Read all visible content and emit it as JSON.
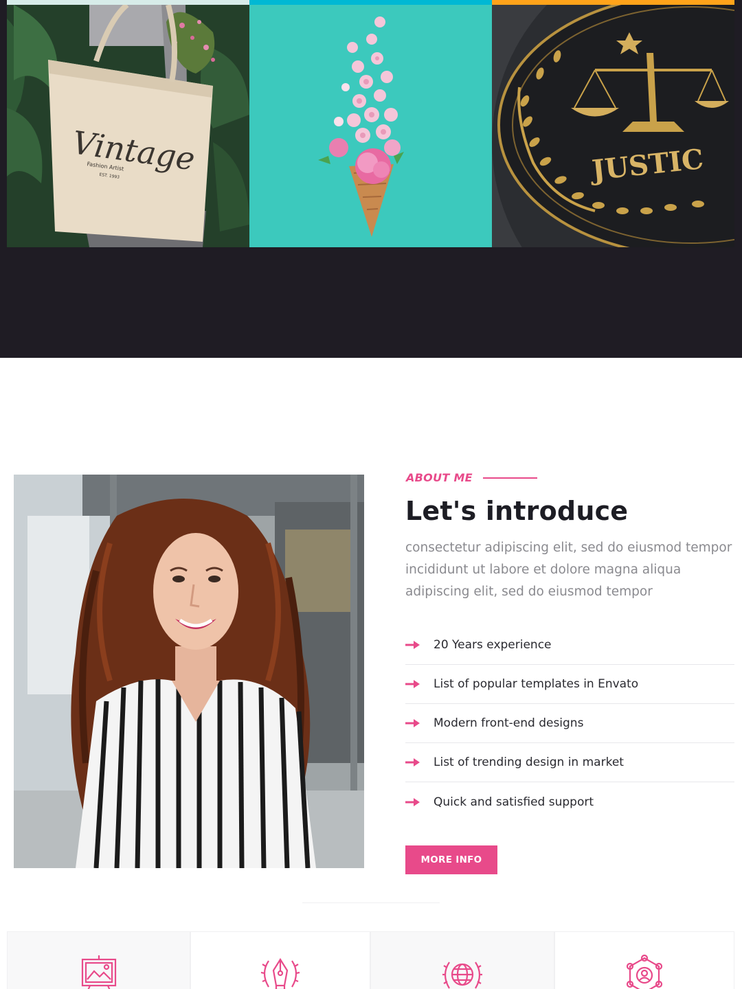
{
  "portfolio": {
    "strip_colors": [
      "#d7ece9",
      "#00b8d4",
      "#ffa31a"
    ],
    "items": [
      {
        "image": "vintage tote bag held in front of green leaves",
        "bag_script": "Vintage",
        "bag_caption": "Fashion Artist",
        "bag_est": "EST. 1993"
      },
      {
        "image": "pink flowers and meringues in an ice cream cone on turquoise"
      },
      {
        "image": "gold justice scales emblem with laurel wreath",
        "emblem_text": "JUSTIC"
      }
    ]
  },
  "about": {
    "kicker": "ABOUT ME",
    "title": "Let's introduce",
    "text": "consectetur adipiscing elit, sed do eiusmod tempor incididunt ut labore et dolore magna aliqua adipiscing elit, sed do eiusmod tempor",
    "features": [
      "20 Years experience",
      "List of popular templates in Envato",
      "Modern front-end designs",
      "List of trending design in market",
      "Quick and satisfied support"
    ],
    "button_label": "MORE INFO",
    "portrait": "smiling woman with long curly red hair in a striped shirt"
  },
  "colors": {
    "accent": "#e84a8a",
    "dark": "#1f1c24",
    "heading": "#1d1d24",
    "body_text": "#8a8a8f"
  },
  "services": {
    "icons": [
      "easel-picture-icon",
      "pen-nib-laurel-icon",
      "globe-laurel-icon",
      "user-network-icon"
    ]
  }
}
